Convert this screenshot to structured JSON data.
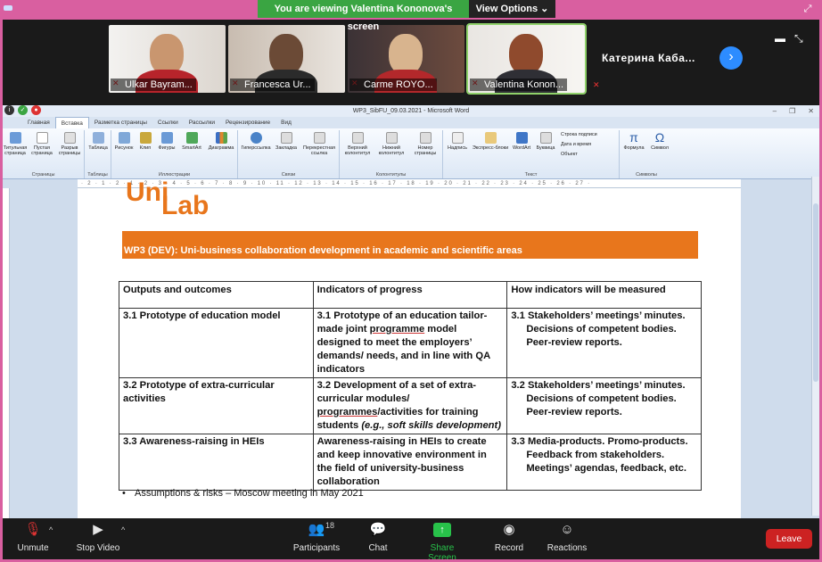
{
  "banner": {
    "viewing_text": "You are viewing Valentina Kononova's screen",
    "view_options": "View Options"
  },
  "participants": [
    {
      "name": "Ulkar Bayram...",
      "active": false
    },
    {
      "name": "Francesca Ur...",
      "active": false
    },
    {
      "name": "Carme ROYO...",
      "active": false
    },
    {
      "name": "Valentina Konon...",
      "active": true
    }
  ],
  "name_only_participant": "Катерина Каба...",
  "word": {
    "title": "WP3_SibFU_09.03.2021 - Microsoft Word",
    "tabs": [
      "Главная",
      "Вставка",
      "Разметка страницы",
      "Ссылки",
      "Рассылки",
      "Рецензирование",
      "Вид"
    ],
    "active_tab": "Вставка",
    "groups": {
      "pages": "Страницы",
      "tables": "Таблицы",
      "illustrations": "Иллюстрации",
      "links": "Связи",
      "header_footer": "Колонтитулы",
      "text": "Текст",
      "symbols": "Символы"
    },
    "buttons": {
      "cover_page": "Титульная страница",
      "blank_page": "Пустая страница",
      "page_break": "Разрыв страницы",
      "table": "Таблица",
      "picture": "Рисунок",
      "clip": "Клип",
      "shapes": "Фигуры",
      "smartart": "SmartArt",
      "chart": "Диаграмма",
      "hyperlink": "Гиперссылка",
      "bookmark": "Закладка",
      "cross_ref": "Перекрестная ссылка",
      "header": "Верхний колонтитул",
      "footer": "Нижний колонтитул",
      "page_number": "Номер страницы",
      "text_box": "Надпись",
      "quick_parts": "Экспресс-блоки",
      "wordart": "WordArt",
      "dropcap": "Буквица",
      "sigline": "Строка подписи",
      "datetime": "Дата и время",
      "object": "Объект",
      "formula": "Формула",
      "symbol": "Символ"
    },
    "ruler_text": "· 2 · 1 · 2 · 1 · 2 · 3 · 4 · 5 · 6 · 7 · 8 · 9 · 10 · 11 · 12 · 13 · 14 · 15 · 16 · 17 · 18 · 19 · 20 · 21 · 22 · 23 · 24 · 25 · 26 · 27 ·"
  },
  "document": {
    "logo_top": "Uni",
    "logo_bottom": "Lab",
    "banner_text": "WP3 (DEV): Uni-business collaboration development in academic and scientific areas",
    "table": {
      "headers": [
        "Outputs and outcomes",
        "Indicators of progress",
        "How indicators will be measured"
      ],
      "rows": [
        {
          "c1": "3.1 Prototype of education model",
          "c2_a": "3.1 Prototype of an education tailor-made joint ",
          "c2_u": "programme",
          "c2_b": " model designed to meet the employers’ demands/ needs, and in line with QA indicators",
          "c3_l1": "3.1 Stakeholders’ meetings’ minutes.",
          "c3_l2": "Decisions of competent bodies.",
          "c3_l3": "Peer-review reports."
        },
        {
          "c1": "3.2 Prototype of extra-curricular activities",
          "c2_a": "3.2 Development of a set of extra-curricular modules/ ",
          "c2_u": "programmes",
          "c2_b": "/activities for training students ",
          "c2_i": "(e.g., soft skills development)",
          "c3_l1": "3.2 Stakeholders’ meetings’ minutes.",
          "c3_l2": "Decisions of competent bodies.",
          "c3_l3": "Peer-review reports."
        },
        {
          "c1": "3.3 Awareness-raising in HEIs",
          "c2": "Awareness-raising in HEIs to create and keep innovative environment in the field of university-business collaboration",
          "c3_l1": "3.3 Media-products. Promo-products.",
          "c3_l2": "Feedback from stakeholders.",
          "c3_l3": "Meetings’ agendas, feedback, etc."
        }
      ]
    },
    "bullet": "Assumptions & risks – Moscow meeting in May 2021"
  },
  "toolbar": {
    "unmute": "Unmute",
    "stop_video": "Stop Video",
    "participants": "Participants",
    "participants_count": "18",
    "chat": "Chat",
    "share_screen": "Share Screen",
    "record": "Record",
    "reactions": "Reactions",
    "leave": "Leave"
  },
  "colors": {
    "zoom_green": "#3aa542",
    "share_green": "#28c24a",
    "leave_red": "#cc2222",
    "accent_orange": "#e8761c",
    "frame_pink": "#d95fa0"
  }
}
